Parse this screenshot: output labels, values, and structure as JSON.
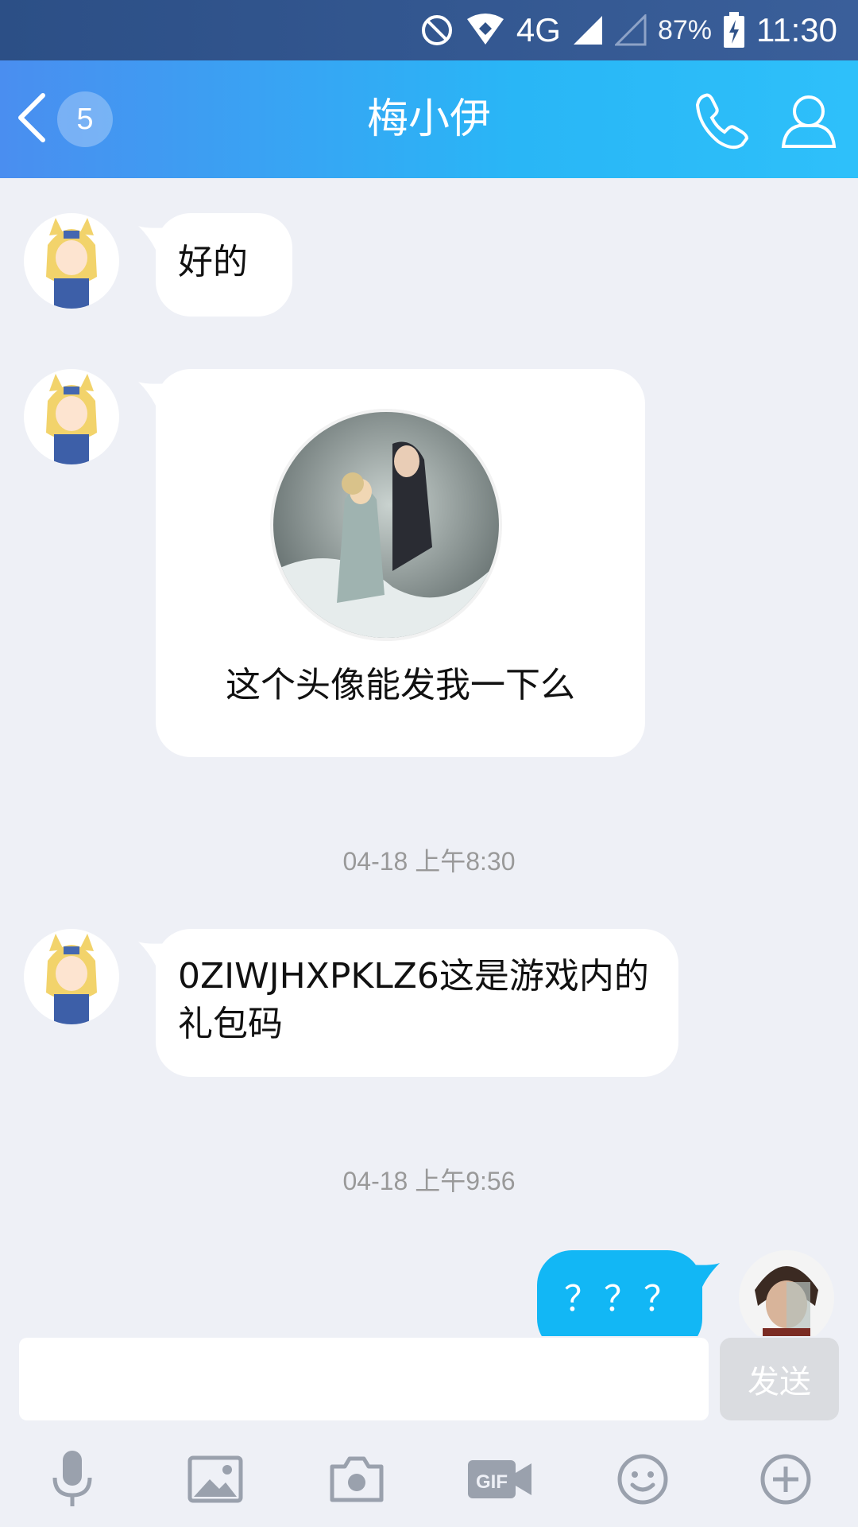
{
  "status_bar": {
    "network": "4G",
    "battery": "87%",
    "time": "11:30"
  },
  "header": {
    "back_badge": "5",
    "title": "梅小伊"
  },
  "messages": [
    {
      "sender": "other",
      "text": "好的"
    },
    {
      "sender": "other",
      "text": "这个头像能发我一下么",
      "has_image": true
    },
    {
      "type": "timestamp",
      "text": "04-18 上午8:30"
    },
    {
      "sender": "other",
      "text": "0ZIWJHXPKLZ6这是游戏内的礼包码"
    },
    {
      "type": "timestamp",
      "text": "04-18 上午9:56"
    },
    {
      "sender": "me",
      "text": "？？？"
    }
  ],
  "input": {
    "value": "",
    "send_label": "发送"
  },
  "toolbar": {
    "icons": [
      "microphone-icon",
      "image-icon",
      "camera-icon",
      "gif-icon",
      "emoji-icon",
      "plus-icon"
    ]
  },
  "colors": {
    "header_start": "#4a8ef0",
    "header_end": "#2ec0fa",
    "my_bubble": "#12b7f5",
    "background": "#eef0f6"
  }
}
